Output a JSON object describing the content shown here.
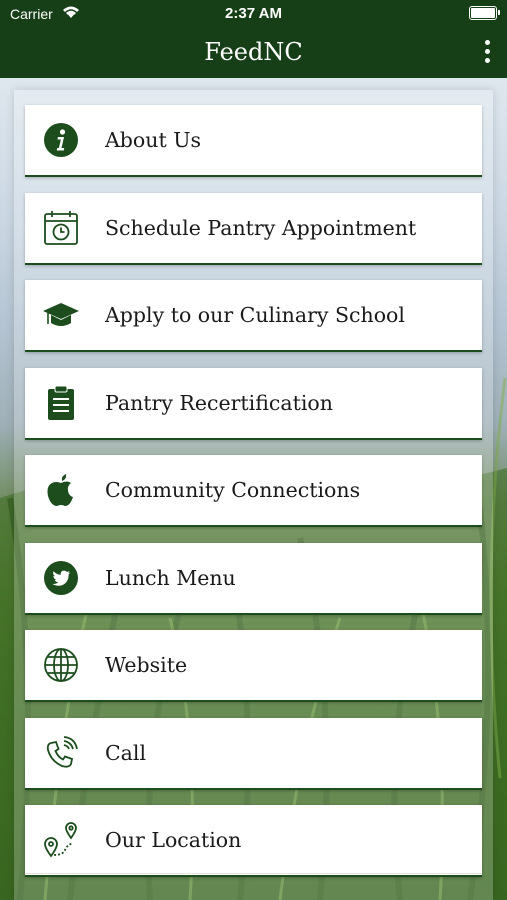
{
  "status_bar": {
    "carrier": "Carrier",
    "time": "2:37 AM"
  },
  "nav": {
    "title": "FeedNC"
  },
  "colors": {
    "brand_green": "#173f17",
    "icon_green": "#1d4d1d"
  },
  "menu": [
    {
      "label": "About Us",
      "icon": "info-icon"
    },
    {
      "label": "Schedule Pantry Appointment",
      "icon": "calendar-clock-icon"
    },
    {
      "label": "Apply to our Culinary School",
      "icon": "graduation-cap-icon"
    },
    {
      "label": "Pantry Recertification",
      "icon": "clipboard-icon"
    },
    {
      "label": "Community Connections",
      "icon": "apple-icon"
    },
    {
      "label": "Lunch Menu",
      "icon": "twitter-icon"
    },
    {
      "label": "Website",
      "icon": "globe-icon"
    },
    {
      "label": "Call",
      "icon": "phone-icon"
    },
    {
      "label": "Our Location",
      "icon": "map-route-icon"
    }
  ]
}
